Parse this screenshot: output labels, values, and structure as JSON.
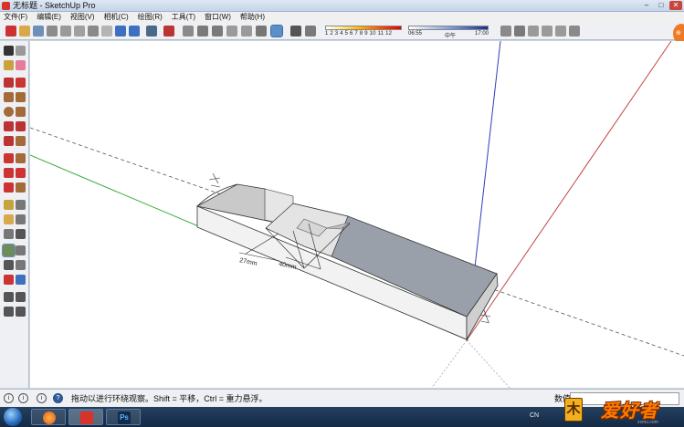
{
  "window": {
    "title": "无标题 - SketchUp Pro",
    "controls": [
      "–",
      "□",
      "✕"
    ]
  },
  "menu": {
    "items": [
      "文件(F)",
      "编辑(E)",
      "视图(V)",
      "相机(C)",
      "绘图(R)",
      "工具(T)",
      "窗口(W)",
      "帮助(H)"
    ]
  },
  "shadow": {
    "months": "1 2 3 4 5 6 7 8 9 10 11 12"
  },
  "time": {
    "start": "06:55",
    "mid": "中午",
    "end": "17:00"
  },
  "viewport": {
    "dim_label_1": "27mm",
    "dim_label_2": "40mm",
    "axis_colors": {
      "blue": "#2a3fbf",
      "red": "#c24444",
      "green": "#3aaa3a"
    }
  },
  "status": {
    "hint": "拖动以进行环绕观察。Shift = 平移，Ctrl = 重力悬浮。",
    "measure_label": "数值"
  },
  "taskbar": {
    "input_lang": "CN",
    "watermark_char": "木",
    "watermark_text": "爱好者",
    "watermark_sub": "zxmu.com"
  },
  "icons": {
    "status": [
      "info-icon",
      "info-icon",
      "info-icon",
      "help-icon"
    ],
    "taskbar": [
      "start-orb-icon",
      "firefox-icon",
      "sketchup-icon",
      "photoshop-icon"
    ]
  }
}
